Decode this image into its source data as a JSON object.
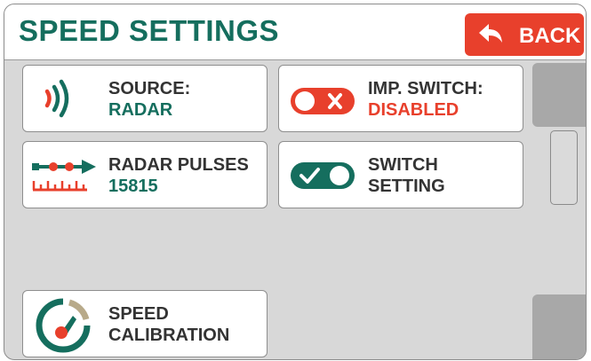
{
  "header": {
    "title": "SPEED SETTINGS",
    "back_label": "BACK"
  },
  "tiles": {
    "source": {
      "label": "SOURCE:",
      "value": "RADAR",
      "icon": "radar-waves-icon"
    },
    "imp_switch": {
      "label": "IMP. SWITCH:",
      "value": "DISABLED",
      "icon": "toggle-off-icon"
    },
    "radar_pulses": {
      "label": "RADAR PULSES",
      "value": "15815",
      "icon": "radar-pulses-icon"
    },
    "switch_setting": {
      "label_line1": "SWITCH",
      "label_line2": "SETTING",
      "icon": "toggle-on-icon"
    },
    "speed_calibration": {
      "label_line1": "SPEED",
      "label_line2": "CALIBRATION",
      "icon": "speedometer-icon"
    }
  },
  "colors": {
    "accent_green": "#156e5e",
    "accent_red": "#e8402c",
    "background": "#d8d8d8"
  }
}
